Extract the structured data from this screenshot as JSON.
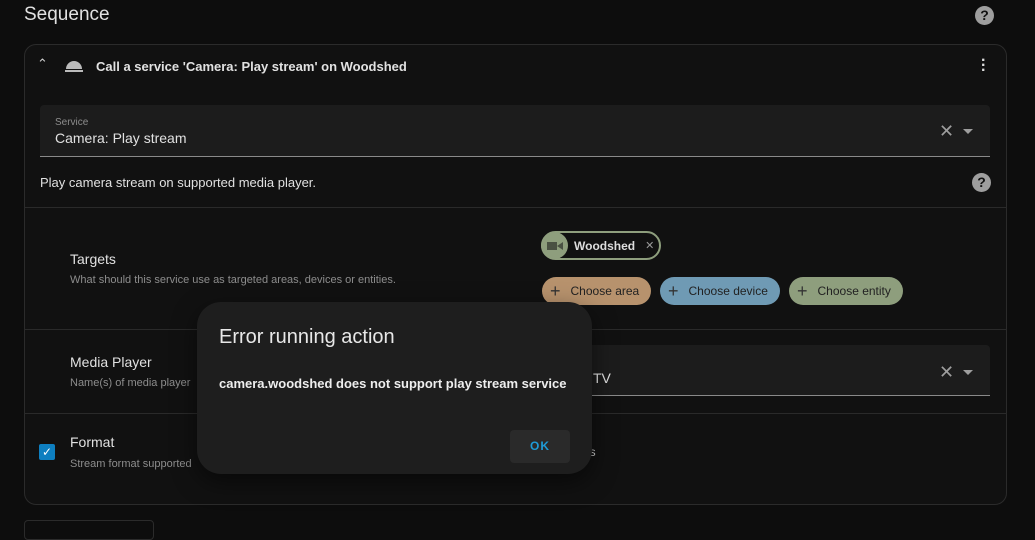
{
  "page": {
    "title": "Sequence"
  },
  "action": {
    "title": "Call a service 'Camera: Play stream' on Woodshed",
    "service": {
      "label": "Service",
      "value": "Camera: Play stream"
    },
    "description": "Play camera stream on supported media player.",
    "targets": {
      "label": "Targets",
      "description": "What should this service use as targeted areas, devices or entities.",
      "chip": "Woodshed",
      "choose_area": "Choose area",
      "choose_device": "Choose device",
      "choose_entity": "Choose entity"
    },
    "media_player": {
      "label": "Media Player",
      "description": "Name(s) of media player",
      "value_visible": "TV"
    },
    "format": {
      "label": "Format",
      "description": "Stream format supported",
      "value_visible": "ls",
      "checked": true
    }
  },
  "dialog": {
    "title": "Error running action",
    "message": "camera.woodshed does not support play stream service",
    "ok": "OK"
  },
  "colors": {
    "area": "#b7926d",
    "device": "#6f9ab4",
    "entity": "#8e9e7d",
    "accent": "#1e9bd7"
  }
}
